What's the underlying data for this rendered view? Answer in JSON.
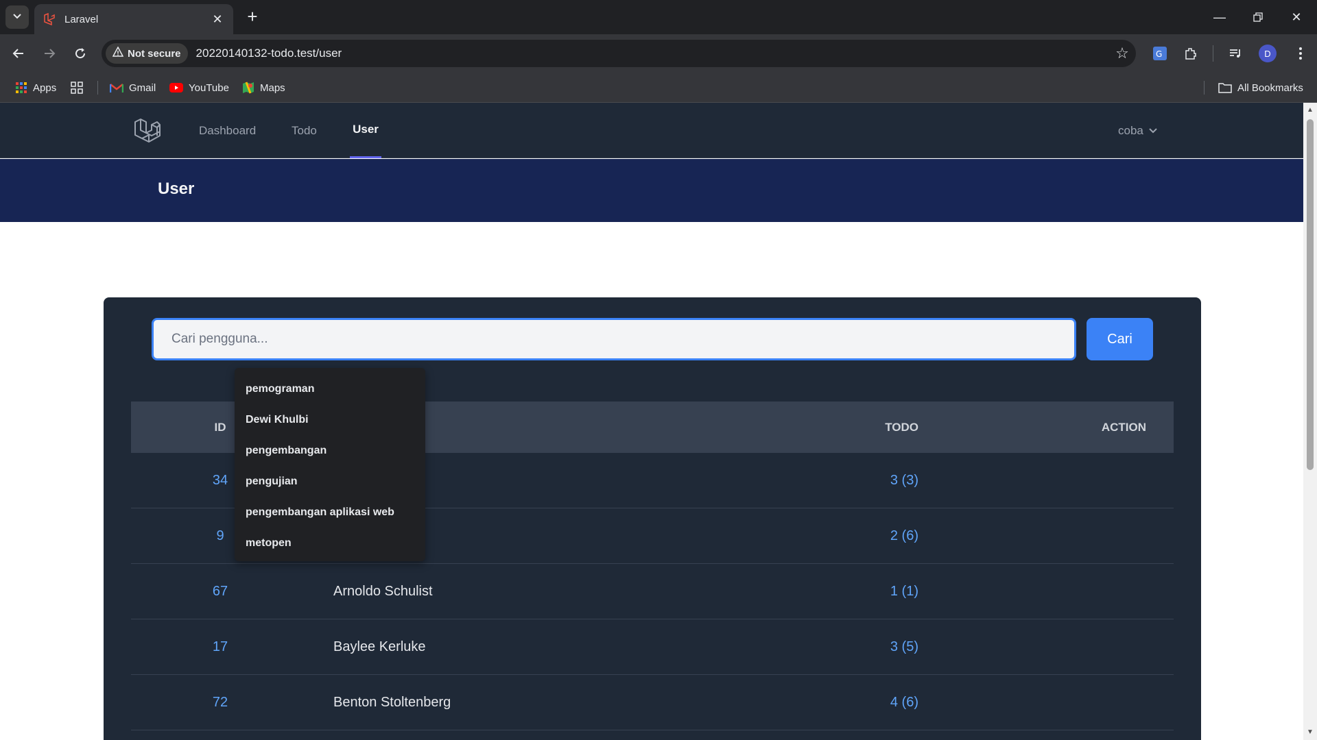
{
  "browser": {
    "tab_title": "Laravel",
    "url": "20220140132-todo.test/user",
    "security_label": "Not secure",
    "profile_initial": "D",
    "bookmarks": [
      "Apps",
      "Gmail",
      "YouTube",
      "Maps"
    ],
    "all_bookmarks": "All Bookmarks"
  },
  "nav": {
    "links": [
      "Dashboard",
      "Todo",
      "User"
    ],
    "active": "User",
    "user_name": "coba"
  },
  "header": {
    "title": "User"
  },
  "search": {
    "placeholder": "Cari pengguna...",
    "button": "Cari"
  },
  "autocomplete": [
    "pemograman",
    "Dewi Khulbi",
    "pengembangan",
    "pengujian",
    "pengembangan aplikasi web",
    "metopen"
  ],
  "table": {
    "headers": [
      "ID",
      "TODO",
      "ACTION"
    ],
    "rows": [
      {
        "id": "34",
        "name": "",
        "todo": "3 (3)"
      },
      {
        "id": "9",
        "name": "",
        "todo": "2 (6)"
      },
      {
        "id": "67",
        "name": "Arnoldo Schulist",
        "todo": "1 (1)"
      },
      {
        "id": "17",
        "name": "Baylee Kerluke",
        "todo": "3 (5)"
      },
      {
        "id": "72",
        "name": "Benton Stoltenberg",
        "todo": "4 (6)"
      }
    ]
  },
  "colors": {
    "accent": "#3b82f6",
    "nav_bg": "#1f2937",
    "header_bg": "#172554",
    "link": "#60a5fa"
  }
}
